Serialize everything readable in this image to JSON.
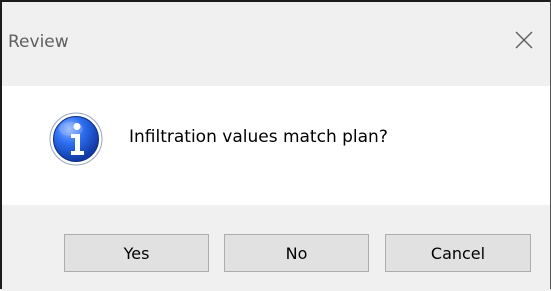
{
  "window": {
    "title": "Review",
    "close_icon": "close-icon"
  },
  "message": {
    "icon": "info-icon",
    "text": "Infiltration values match plan?"
  },
  "buttons": {
    "yes_label": "Yes",
    "no_label": "No",
    "cancel_label": "Cancel"
  },
  "colors": {
    "icon_blue": "#1f4fd1",
    "content_background": "#ffffff",
    "dialog_background": "#f0f0f0",
    "button_background": "#e1e1e1",
    "button_border": "#adadad"
  }
}
